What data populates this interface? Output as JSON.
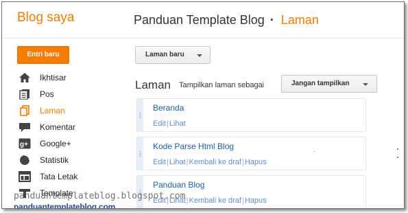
{
  "header": {
    "brand": "Blog saya",
    "blog_title": "Panduan Template Blog",
    "separator": "·",
    "current_section": "Laman"
  },
  "sidebar": {
    "new_post_label": "Entri baru",
    "items": [
      {
        "label": "Ikhtisar",
        "icon": "home-icon",
        "active": false
      },
      {
        "label": "Pos",
        "icon": "posts-icon",
        "active": false
      },
      {
        "label": "Laman",
        "icon": "pages-icon",
        "active": true
      },
      {
        "label": "Komentar",
        "icon": "comment-icon",
        "active": false
      },
      {
        "label": "Google+",
        "icon": "google-plus-icon",
        "active": false
      },
      {
        "label": "Statistik",
        "icon": "stats-icon",
        "active": false
      },
      {
        "label": "Tata Letak",
        "icon": "layout-icon",
        "active": false
      },
      {
        "label": "Template",
        "icon": "template-icon",
        "active": false
      }
    ]
  },
  "main": {
    "new_page_label": "Laman baru",
    "section_title": "Laman",
    "show_pages_label": "Tampilkan laman sebagai",
    "show_pages_value": "Jangan tampilkan",
    "pages": [
      {
        "title": "Beranda",
        "actions": [
          "Edit",
          "Lihat"
        ]
      },
      {
        "title": "Kode Parse Html Blog",
        "actions": [
          "Edit",
          "Lihat",
          "Kembali ke draf",
          "Hapus"
        ]
      },
      {
        "title": "Panduan Blog",
        "actions": [
          "Edit",
          "Lihat",
          "Kembali ke draf",
          "Hapus"
        ]
      }
    ]
  },
  "watermark": {
    "url_text": "panduantemplateblog.blogspot.com",
    "bold_text": "panduantemplateblog.com"
  },
  "colors": {
    "accent": "#f57d00",
    "link": "#1a5fa8",
    "action_link": "#5a8ed6"
  }
}
